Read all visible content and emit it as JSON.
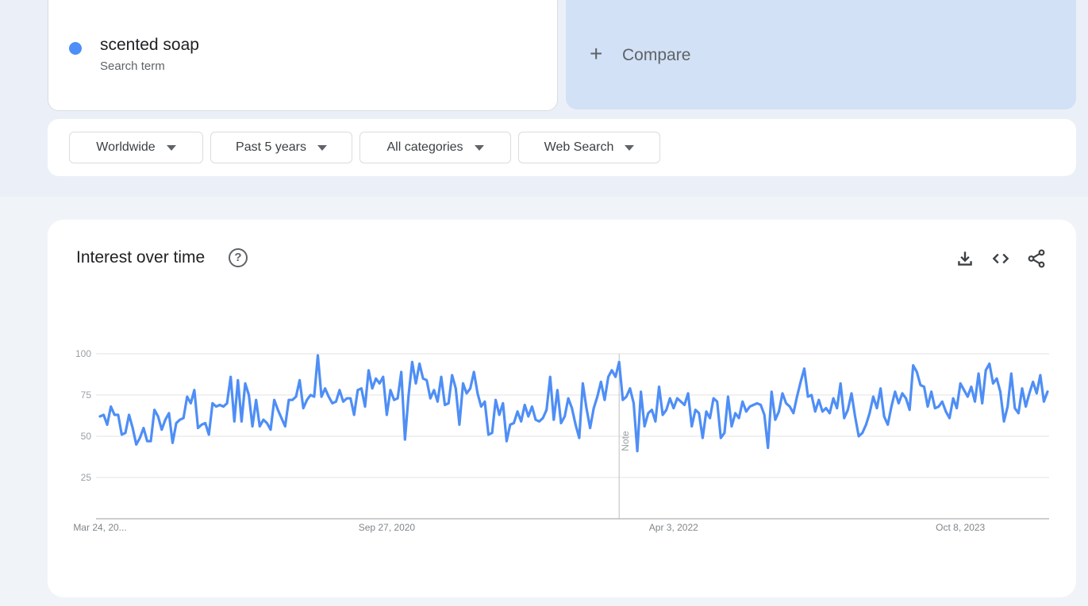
{
  "search_term": {
    "name": "scented soap",
    "subtitle": "Search term",
    "color": "#4e8ef6"
  },
  "compare": {
    "plus": "+",
    "label": "Compare"
  },
  "filters": [
    {
      "label": "Worldwide"
    },
    {
      "label": "Past 5 years"
    },
    {
      "label": "All categories"
    },
    {
      "label": "Web Search"
    }
  ],
  "panel": {
    "title": "Interest over time",
    "help": "?",
    "icons": [
      "download-icon",
      "embed-code-icon",
      "share-icon"
    ]
  },
  "chart_data": {
    "type": "line",
    "title": "",
    "xlabel": "",
    "ylabel": "",
    "ylim": [
      0,
      100
    ],
    "yticks": [
      25,
      50,
      75,
      100
    ],
    "grid": true,
    "line_color": "#4e8ef6",
    "x_tick_labels": [
      "Mar 24, 20...",
      "Sep 27, 2020",
      "Apr 3, 2022",
      "Oct 8, 2023"
    ],
    "x_tick_week_index": [
      0,
      79,
      158,
      237
    ],
    "note": {
      "label": "Note",
      "week_index": 143
    },
    "series": [
      {
        "name": "",
        "values": [
          62,
          63,
          57,
          68,
          63,
          63,
          51,
          52,
          63,
          55,
          45,
          49,
          55,
          47,
          47,
          66,
          62,
          54,
          60,
          64,
          46,
          58,
          60,
          61,
          74,
          70,
          78,
          55,
          57,
          58,
          51,
          70,
          68,
          69,
          68,
          70,
          86,
          59,
          84,
          59,
          82,
          75,
          56,
          72,
          56,
          60,
          58,
          54,
          72,
          66,
          61,
          56,
          72,
          72,
          74,
          84,
          67,
          72,
          75,
          74,
          99,
          74,
          79,
          74,
          70,
          71,
          78,
          71,
          73,
          73,
          63,
          78,
          79,
          68,
          90,
          79,
          85,
          82,
          86,
          63,
          78,
          72,
          73,
          89,
          48,
          75,
          95,
          82,
          94,
          85,
          84,
          73,
          78,
          71,
          86,
          69,
          70,
          87,
          79,
          57,
          82,
          76,
          79,
          89,
          76,
          68,
          71,
          51,
          52,
          72,
          63,
          70,
          47,
          57,
          58,
          65,
          59,
          69,
          62,
          68,
          60,
          59,
          61,
          66,
          86,
          60,
          78,
          58,
          62,
          73,
          67,
          57,
          49,
          82,
          67,
          55,
          67,
          74,
          83,
          72,
          86,
          90,
          86,
          95,
          72,
          74,
          79,
          70,
          41,
          77,
          56,
          64,
          66,
          59,
          80,
          63,
          66,
          73,
          67,
          73,
          71,
          69,
          76,
          56,
          66,
          64,
          49,
          65,
          61,
          73,
          71,
          49,
          52,
          74,
          56,
          64,
          61,
          71,
          65,
          68,
          69,
          70,
          69,
          63,
          43,
          77,
          60,
          65,
          76,
          70,
          68,
          64,
          74,
          83,
          91,
          74,
          75,
          65,
          72,
          65,
          67,
          64,
          73,
          67,
          82,
          61,
          66,
          76,
          62,
          50,
          52,
          57,
          64,
          74,
          67,
          79,
          62,
          57,
          68,
          77,
          70,
          76,
          73,
          66,
          93,
          89,
          81,
          80,
          68,
          77,
          67,
          68,
          71,
          65,
          61,
          73,
          67,
          82,
          78,
          74,
          80,
          71,
          88,
          70,
          90,
          94,
          82,
          85,
          77,
          59,
          68,
          88,
          67,
          64,
          79,
          68,
          76,
          83,
          76,
          87,
          71,
          77
        ]
      }
    ]
  }
}
